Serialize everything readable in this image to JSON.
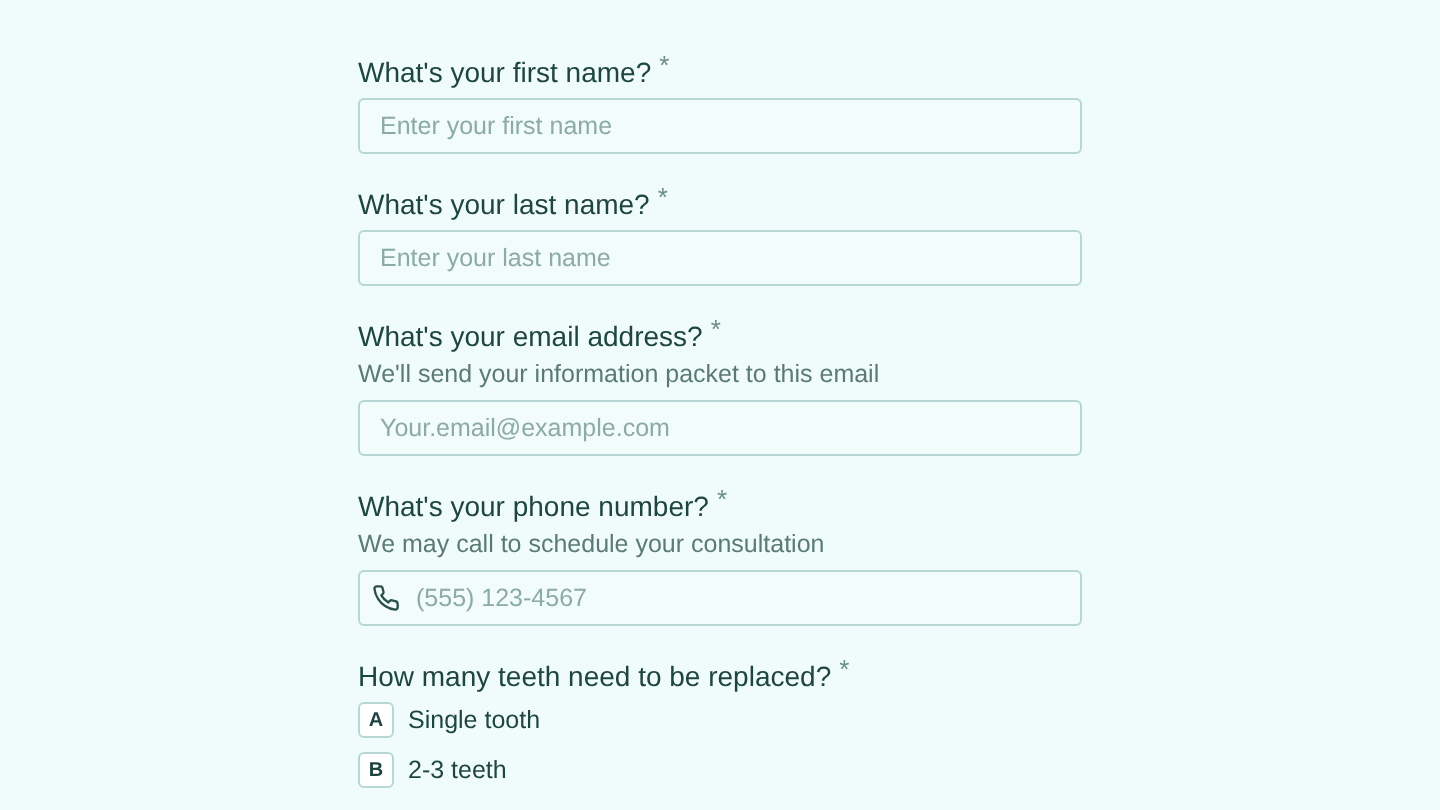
{
  "questions": [
    {
      "kind": "text",
      "label": "What's your first name?",
      "required_mark": "*",
      "placeholder": "Enter your first name"
    },
    {
      "kind": "text",
      "label": "What's your last name?",
      "required_mark": "*",
      "placeholder": "Enter your last name"
    },
    {
      "kind": "text",
      "label": "What's your email address?",
      "required_mark": "*",
      "hint": "We'll send your information packet to this email",
      "placeholder": "Your.email@example.com"
    },
    {
      "kind": "phone",
      "label": "What's your phone number?",
      "required_mark": "*",
      "hint": "We may call to schedule your consultation",
      "placeholder": "(555) 123-4567"
    },
    {
      "kind": "choice",
      "label": "How many teeth need to be replaced?",
      "required_mark": "*",
      "options": [
        {
          "key": "A",
          "label": "Single tooth"
        },
        {
          "key": "B",
          "label": "2-3 teeth"
        }
      ]
    }
  ]
}
